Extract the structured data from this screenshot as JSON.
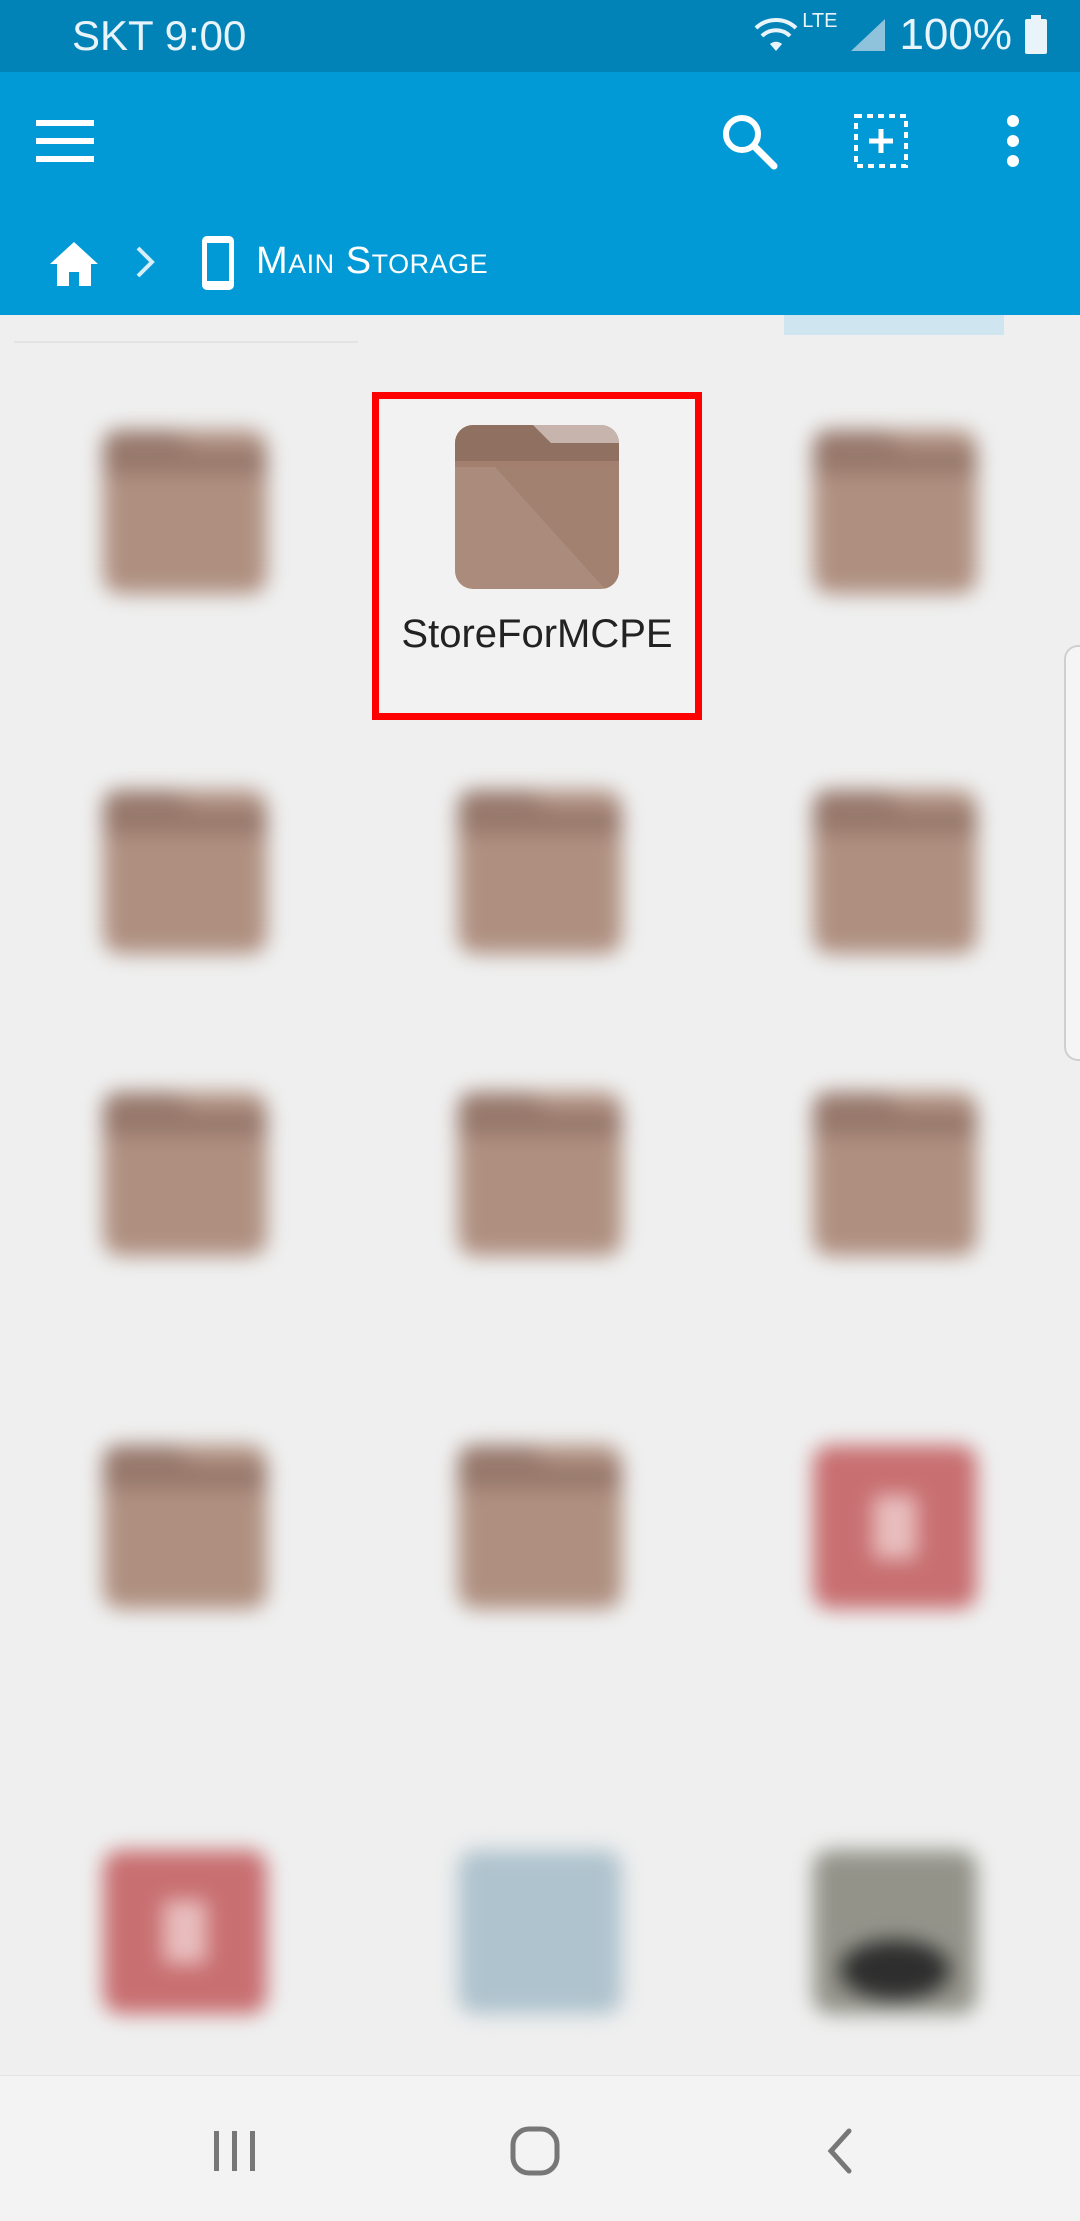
{
  "status_bar": {
    "carrier_time": "SKT 9:00",
    "network": "LTE",
    "battery": "100%"
  },
  "app_bar": {
    "icons": [
      "menu-icon",
      "search-icon",
      "select-icon",
      "more-vert-icon"
    ]
  },
  "breadcrumb": {
    "location": "Main Storage"
  },
  "selected_item": {
    "name": "StoreForMCPE",
    "type": "folder"
  },
  "colors": {
    "status_bar": "#0283b8",
    "app_bar": "#029ad6",
    "folder": "#a98675",
    "highlight": "#ff0000"
  }
}
